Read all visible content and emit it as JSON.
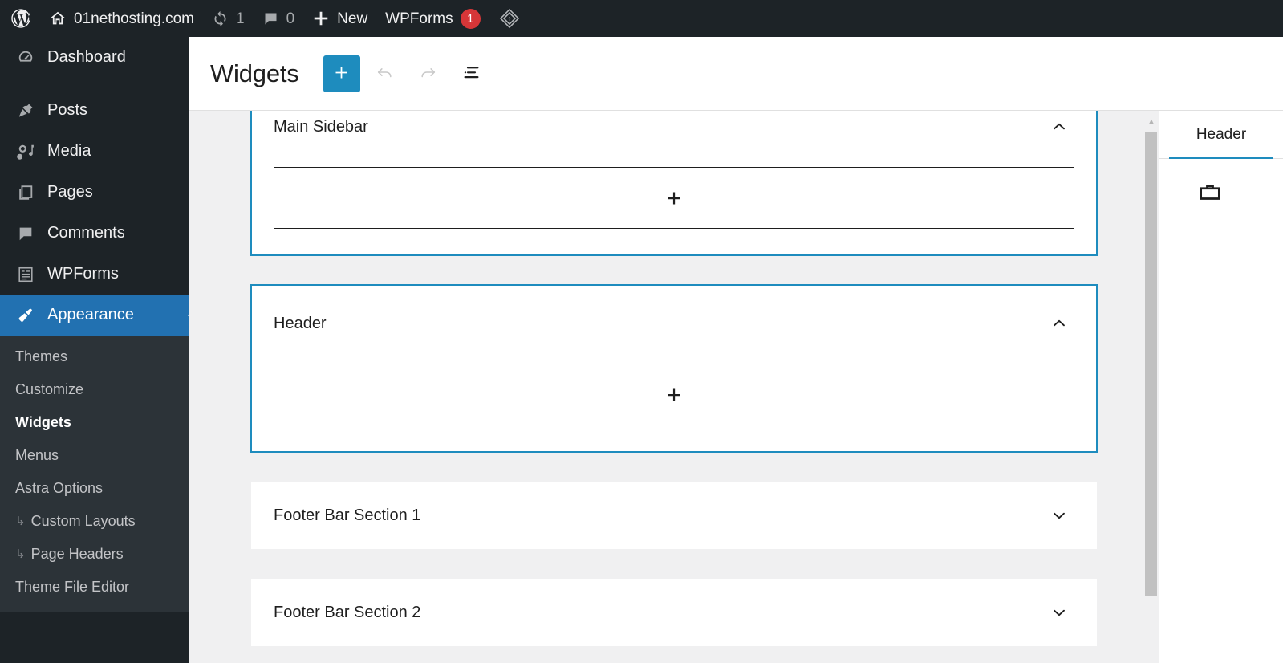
{
  "admin_bar": {
    "items": [
      {
        "name": "wordpress-logo",
        "icon": "wordpress-icon",
        "label": ""
      },
      {
        "name": "site-name",
        "icon": "home-icon",
        "label": "01nethosting.com"
      },
      {
        "name": "updates",
        "icon": "updates-icon",
        "label": "1"
      },
      {
        "name": "comments",
        "icon": "comment-bubble-icon",
        "label": "0"
      },
      {
        "name": "new-content",
        "icon": "plus-icon",
        "label": "New"
      },
      {
        "name": "wpforms",
        "icon": "",
        "label": "WPForms",
        "badge": "1"
      },
      {
        "name": "performance-plugin",
        "icon": "diamond-bolt-icon",
        "label": ""
      }
    ]
  },
  "admin_menu": {
    "items": [
      {
        "label": "Dashboard",
        "icon": "dashboard-icon",
        "current": false
      },
      {
        "label": "Posts",
        "icon": "pin-icon",
        "current": false
      },
      {
        "label": "Media",
        "icon": "media-icon",
        "current": false
      },
      {
        "label": "Pages",
        "icon": "pages-icon",
        "current": false
      },
      {
        "label": "Comments",
        "icon": "comment-icon",
        "current": false
      },
      {
        "label": "WPForms",
        "icon": "wpforms-icon",
        "current": false
      },
      {
        "label": "Appearance",
        "icon": "paintbrush-icon",
        "current": true
      }
    ],
    "submenu": [
      {
        "label": "Themes",
        "current": false,
        "nested": false
      },
      {
        "label": "Customize",
        "current": false,
        "nested": false
      },
      {
        "label": "Widgets",
        "current": true,
        "nested": false
      },
      {
        "label": "Menus",
        "current": false,
        "nested": false
      },
      {
        "label": "Astra Options",
        "current": false,
        "nested": false
      },
      {
        "label": "Custom Layouts",
        "current": false,
        "nested": true
      },
      {
        "label": "Page Headers",
        "current": false,
        "nested": true
      },
      {
        "label": "Theme File Editor",
        "current": false,
        "nested": false
      }
    ],
    "nested_arrow": "↳"
  },
  "editor_header": {
    "title": "Widgets",
    "buttons": [
      {
        "name": "add-block-button",
        "icon": "plus-icon",
        "label": "+",
        "state": "primary"
      },
      {
        "name": "undo-button",
        "icon": "undo-arrow-icon",
        "label": "",
        "state": "disabled"
      },
      {
        "name": "redo-button",
        "icon": "redo-arrow-icon",
        "label": "",
        "state": "disabled"
      },
      {
        "name": "list-view-button",
        "icon": "list-view-icon",
        "label": "",
        "state": "enabled"
      }
    ]
  },
  "widget_areas": [
    {
      "name": "main-sidebar",
      "title": "Main Sidebar",
      "expanded": true,
      "selected": true,
      "clipped": true,
      "chevron": "chevron-up-icon",
      "appender_label": "+"
    },
    {
      "name": "header",
      "title": "Header",
      "expanded": true,
      "selected": true,
      "clipped": false,
      "chevron": "chevron-up-icon",
      "appender_label": "+"
    },
    {
      "name": "footer-bar-section-1",
      "title": "Footer Bar Section 1",
      "expanded": false,
      "selected": false,
      "clipped": false,
      "chevron": "chevron-down-icon",
      "appender_label": "+"
    },
    {
      "name": "footer-bar-section-2",
      "title": "Footer Bar Section 2",
      "expanded": false,
      "selected": false,
      "clipped": false,
      "chevron": "chevron-down-icon",
      "appender_label": "+"
    }
  ],
  "inspector": {
    "tabs": [
      {
        "label": "Header",
        "active": true
      }
    ],
    "block_icon": "legacy-widget-icon"
  },
  "colors": {
    "admin_bar_bg": "#1d2327",
    "admin_menu_bg": "#1d2327",
    "submenu_bg": "#2c3338",
    "accent_blue": "#2271b1",
    "editor_accent": "#1e8cbe",
    "badge_red": "#d63638",
    "canvas_bg": "#f0f0f1"
  }
}
